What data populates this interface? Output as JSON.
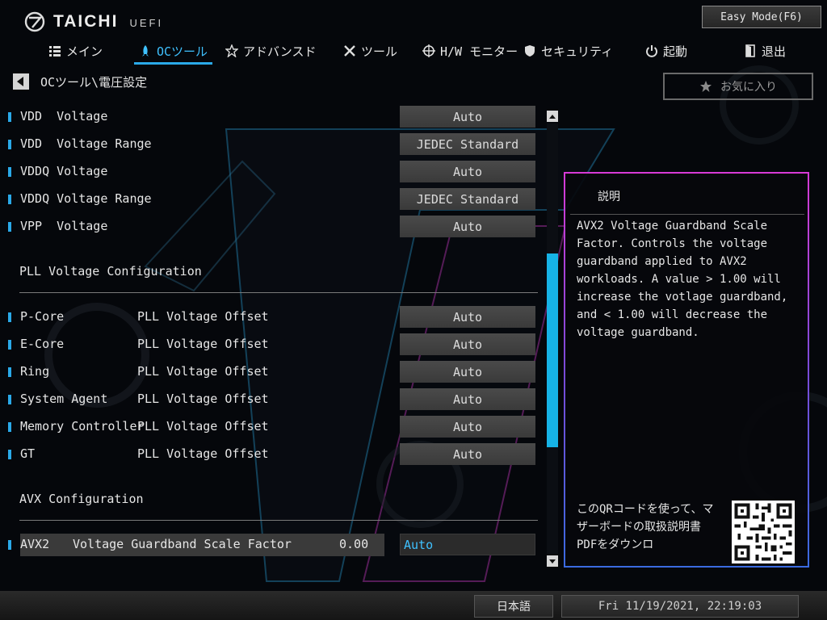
{
  "brand": {
    "name": "TAICHI",
    "suffix": "UEFI"
  },
  "easy_mode_label": "Easy Mode(F6)",
  "nav": [
    {
      "label": "メイン",
      "icon": "list-icon",
      "active": false
    },
    {
      "label": "OCツール",
      "icon": "rocket-icon",
      "active": true
    },
    {
      "label": "アドバンスド",
      "icon": "star-icon",
      "active": false
    },
    {
      "label": "ツール",
      "icon": "wrench-screwdriver-icon",
      "active": false
    },
    {
      "label": "H/W モニター",
      "icon": "crosshair-icon",
      "active": false
    },
    {
      "label": "セキュリティ",
      "icon": "shield-icon",
      "active": false
    },
    {
      "label": "起動",
      "icon": "power-icon",
      "active": false
    },
    {
      "label": "退出",
      "icon": "exit-door-icon",
      "active": false
    }
  ],
  "breadcrumb": "OCツール\\電圧設定",
  "favorite_label": "お気に入り",
  "settings": {
    "rows": [
      {
        "label": "VDD  Voltage",
        "value": "Auto"
      },
      {
        "label": "VDD  Voltage Range",
        "value": "JEDEC Standard"
      },
      {
        "label": "VDDQ Voltage",
        "value": "Auto"
      },
      {
        "label": "VDDQ Voltage Range",
        "value": "JEDEC Standard"
      },
      {
        "label": "VPP  Voltage",
        "value": "Auto"
      }
    ],
    "pll_section": "PLL Voltage Configuration",
    "pll_rows": [
      {
        "label": "P-Core",
        "label2": "PLL Voltage Offset",
        "value": "Auto"
      },
      {
        "label": "E-Core",
        "label2": "PLL Voltage Offset",
        "value": "Auto"
      },
      {
        "label": "Ring",
        "label2": "PLL Voltage Offset",
        "value": "Auto"
      },
      {
        "label": "System Agent",
        "label2": "PLL Voltage Offset",
        "value": "Auto"
      },
      {
        "label": "Memory Controller",
        "label2": "PLL Voltage Offset",
        "value": "Auto"
      },
      {
        "label": "GT",
        "label2": "PLL Voltage Offset",
        "value": "Auto"
      }
    ],
    "avx_section": "AVX Configuration",
    "avx_row": {
      "label": "AVX2",
      "label2": "Voltage Guardband Scale Factor",
      "current": "0.00",
      "value": "Auto"
    }
  },
  "scrollbar": {
    "position": 0.55,
    "thumb_fraction": 0.45
  },
  "description": {
    "title": "説明",
    "text": "AVX2 Voltage Guardband Scale Factor. Controls the voltage guardband applied to AVX2 workloads. A value > 1.00 will increase the votlage guardband, and < 1.00 will decrease the voltage guardband.",
    "qr_text": "このQRコードを使って、マザーボードの取扱説明書PDFをダウンロ"
  },
  "footer": {
    "language": "日本語",
    "datetime": "Fri 11/19/2021, 22:19:03"
  },
  "colors": {
    "accent": "#2aa9e8",
    "highlight": "#3fc1ff",
    "panel_border": "#d73ad6"
  }
}
